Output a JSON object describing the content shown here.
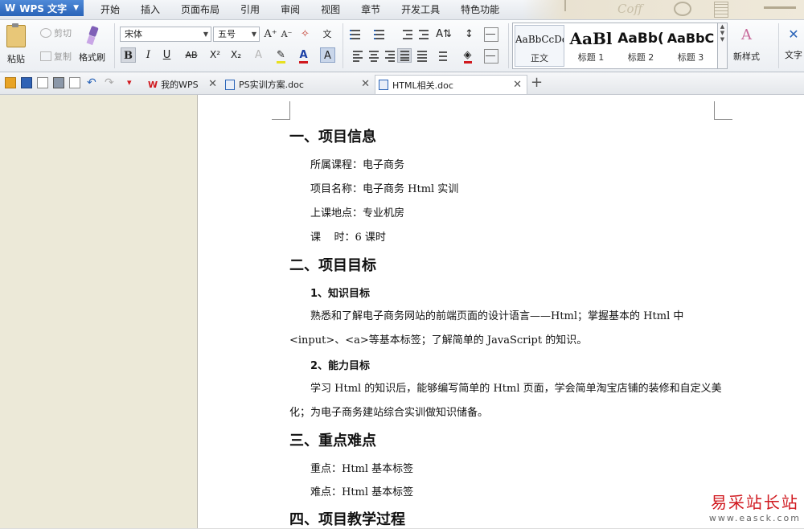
{
  "app": {
    "name": "WPS 文字",
    "logo": "W"
  },
  "menu": {
    "tabs": [
      "开始",
      "插入",
      "页面布局",
      "引用",
      "审阅",
      "视图",
      "章节",
      "开发工具",
      "特色功能"
    ],
    "decoration_text": "Coff"
  },
  "ribbon": {
    "paste_label": "粘贴",
    "cut_label": "剪切",
    "copy_label": "复制",
    "format_painter_label": "格式刷",
    "font_name": "宋体",
    "font_size": "五号",
    "bold": "B",
    "italic": "I",
    "underline": "U",
    "strike": "AB",
    "superscript": "X²",
    "subscript": "X₂",
    "grow_font": "A⁺",
    "shrink_font": "A⁻",
    "char_border": "A",
    "phonetic": "文",
    "styles": [
      {
        "preview": "AaBbCcDd",
        "name": "正文"
      },
      {
        "preview": "AaBl",
        "name": "标题 1"
      },
      {
        "preview": "AaBb(",
        "name": "标题 2"
      },
      {
        "preview": "AaBbC",
        "name": "标题 3"
      }
    ],
    "new_style_label": "新样式",
    "text_tools_label": "文字"
  },
  "doc_tabs": [
    {
      "label": "我的WPS",
      "icon": "wps-logo-icon"
    },
    {
      "label": "PS实训方案.doc",
      "icon": "doc-file-icon"
    },
    {
      "label": "HTML相关.doc",
      "icon": "doc-file-icon",
      "active": true
    }
  ],
  "document": {
    "h_info": "一、项目信息",
    "course": "所属课程：电子商务",
    "project_name": "项目名称：电子商务 Html 实训",
    "location": "上课地点：专业机房",
    "hours": "课    时：6 课时",
    "h_goal": "二、项目目标",
    "knowledge_title": "1、知识目标",
    "knowledge_line1": "熟悉和了解电子商务网站的前端页面的设计语言——Html；掌握基本的 Html 中",
    "knowledge_line2": "<input>、<a>等基本标签；了解简单的 JavaScript 的知识。",
    "ability_title": "2、能力目标",
    "ability_line1": "学习 Html 的知识后，能够编写简单的 Html 页面，学会简单淘宝店铺的装修和自定义美",
    "ability_line2": "化；为电子商务建站综合实训做知识储备。",
    "h_key": "三、重点难点",
    "key_point": "重点：Html 基本标签",
    "difficulty": "难点：Html 基本标签",
    "h_process": "四、项目教学过程"
  },
  "watermark": {
    "line1": "易采站长站",
    "line2": "www.easck.com"
  }
}
